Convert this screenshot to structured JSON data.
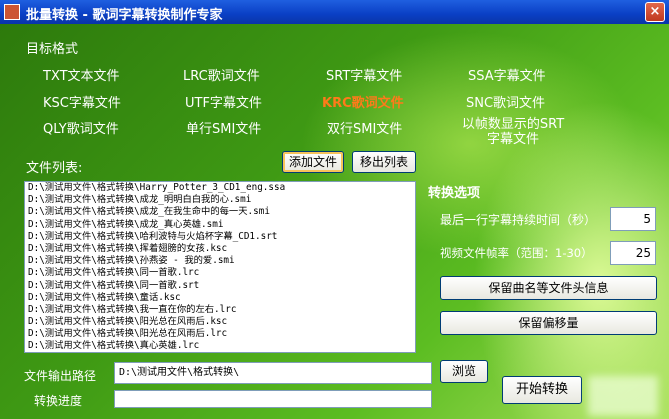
{
  "window": {
    "title": "批量转换 - 歌词字幕转换制作专家",
    "close_label": "×"
  },
  "formats": {
    "section_label": "目标格式",
    "items": [
      {
        "label": "TXT文本文件"
      },
      {
        "label": "LRC歌词文件"
      },
      {
        "label": "SRT字幕文件"
      },
      {
        "label": "SSA字幕文件"
      },
      {
        "label": "KSC字幕文件"
      },
      {
        "label": "UTF字幕文件"
      },
      {
        "label": "KRC歌词文件",
        "selected": true
      },
      {
        "label": "SNC歌词文件"
      },
      {
        "label": "QLY歌词文件"
      },
      {
        "label": "单行SMI文件"
      },
      {
        "label": "双行SMI文件"
      },
      {
        "label": "以帧数显示的SRT字幕文件"
      }
    ]
  },
  "files": {
    "label": "文件列表:",
    "add_button": "添加文件",
    "remove_button": "移出列表",
    "rows": [
      "D:\\测试用文件\\格式转换\\Harry_Potter_3_CD1_eng.ssa",
      "D:\\测试用文件\\格式转换\\成龙_明明白白我的心.smi",
      "D:\\测试用文件\\格式转换\\成龙_在我生命中的每一天.smi",
      "D:\\测试用文件\\格式转换\\成龙_真心英雄.smi",
      "D:\\测试用文件\\格式转换\\哈利波特与火焰杯字幕_CD1.srt",
      "D:\\测试用文件\\格式转换\\挥着翅膀的女孩.ksc",
      "D:\\测试用文件\\格式转换\\孙燕姿 - 我的爱.smi",
      "D:\\测试用文件\\格式转换\\同一首歌.lrc",
      "D:\\测试用文件\\格式转换\\同一首歌.srt",
      "D:\\测试用文件\\格式转换\\童话.ksc",
      "D:\\测试用文件\\格式转换\\我一直在你的左右.lrc",
      "D:\\测试用文件\\格式转换\\阳光总在风雨后.ksc",
      "D:\\测试用文件\\格式转换\\阳光总在风雨后.lrc",
      "D:\\测试用文件\\格式转换\\真心英雄.lrc"
    ]
  },
  "options": {
    "title": "转换选项",
    "last_line_label": "最后一行字幕持续时间（秒）",
    "last_line_value": "5",
    "fps_label": "视频文件帧率（范围：1-30）",
    "fps_value": "25",
    "keep_header_button": "保留曲名等文件头信息",
    "keep_offset_button": "保留偏移量"
  },
  "output": {
    "path_label": "文件输出路径",
    "path_value": "D:\\测试用文件\\格式转换\\",
    "browse_button": "浏览",
    "progress_label": "转换进度",
    "progress_fraction": 0,
    "start_button": "开始转换"
  },
  "colors": {
    "background": "#3f9a14",
    "selected_format": "#ff7a1a",
    "titlebar": "#0a3fc4"
  }
}
